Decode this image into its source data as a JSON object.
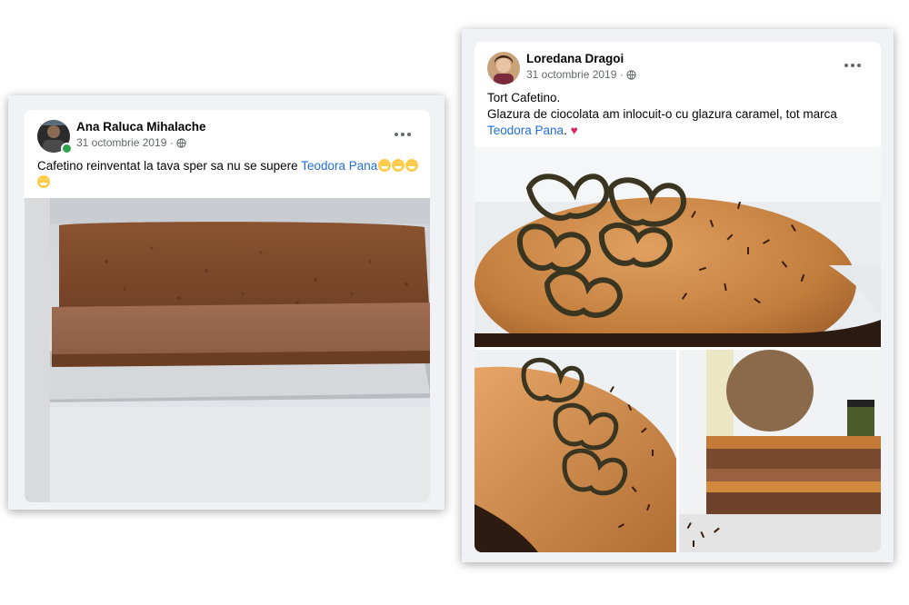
{
  "post1": {
    "author": "Ana Raluca Mihalache",
    "date": "31 octombrie 2019 ·",
    "privacy_icon": "globe-icon",
    "more_icon": "more-dots-icon",
    "text_before": "Cafetino reinventat la tava sper sa nu se supere ",
    "mention": "Teodora Pana",
    "emoji": "grinning-face-icon",
    "online_color": "#31a24c"
  },
  "post2": {
    "author": "Loredana Dragoi",
    "date": "31 octombrie 2019 ·",
    "privacy_icon": "globe-icon",
    "more_icon": "more-dots-icon",
    "line1": "Tort Cafetino.",
    "line2": "Glazura de ciocolata am inlocuit-o cu glazura caramel, tot marca",
    "mention": "Teodora Pana",
    "after_mention": ".",
    "heart": "♥"
  },
  "colors": {
    "mention": "#216fdb",
    "secondary_text": "#65676b",
    "card_frame": "#f0f2f5"
  }
}
